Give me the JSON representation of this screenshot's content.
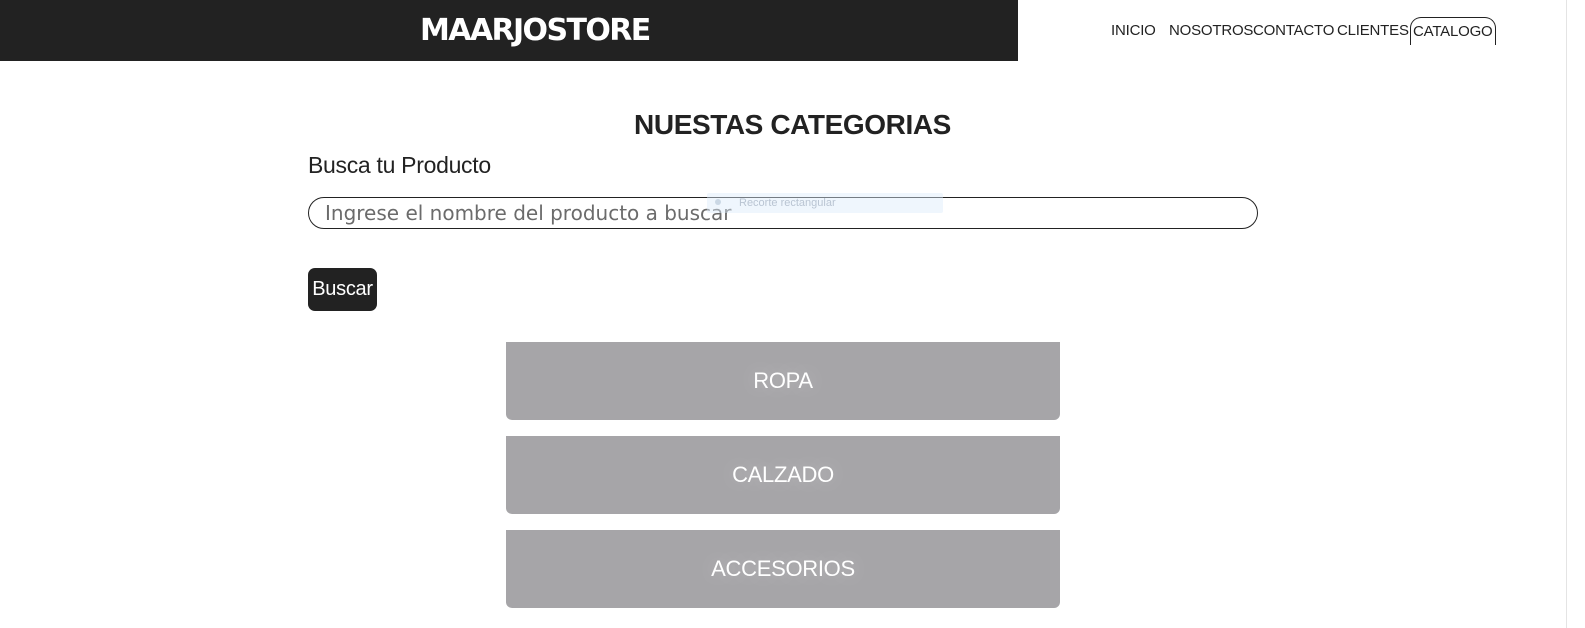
{
  "header": {
    "brand": "MAARJOSTORE",
    "nav_items": [
      {
        "label": "INICIO",
        "active": false
      },
      {
        "label": "NOSOTROS",
        "active": false
      },
      {
        "label": "CONTACTO",
        "active": false
      },
      {
        "label": "CLIENTES",
        "active": false
      },
      {
        "label": "CATALOGO",
        "active": true
      }
    ]
  },
  "main": {
    "title": "NUESTAS CATEGORIAS",
    "search": {
      "label": "Busca tu Producto",
      "placeholder": "Ingrese el nombre del producto a buscar",
      "value": "",
      "button_label": "Buscar"
    },
    "categories": [
      {
        "label": "ROPA"
      },
      {
        "label": "CALZADO"
      },
      {
        "label": "ACCESORIOS"
      }
    ],
    "overlay_tooltip": "Recorte rectangular"
  },
  "colors": {
    "dark": "#222222",
    "category_bg": "#a6a5a8",
    "page_bg": "#ffffff"
  }
}
